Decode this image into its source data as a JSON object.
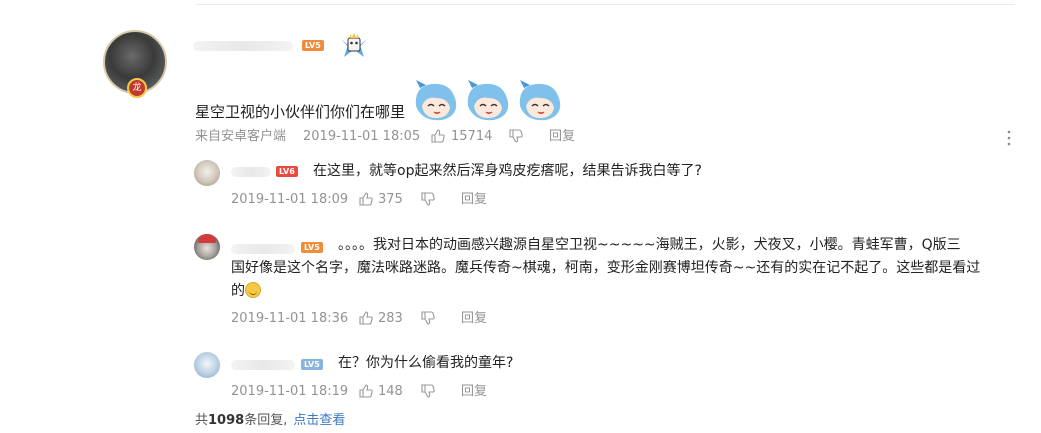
{
  "main": {
    "level": "LV5",
    "text": "星空卫视的小伙伴们你们在哪里",
    "source": "来自安卓客户端",
    "time": "2019-11-01 18:05",
    "likes": "15714",
    "reply_label": "回复"
  },
  "replies": [
    {
      "level": "LV6",
      "text": "在这里，就等op起来然后浑身鸡皮疙瘩呢，结果告诉我白等了?",
      "time": "2019-11-01 18:09",
      "likes": "375",
      "reply_label": "回复"
    },
    {
      "level": "LV5",
      "text_line1": "。。。。我对日本的动画感兴趣源自星空卫视~~~~~海贼王，火影，犬夜叉，小樱。青蛙军曹，Q版三",
      "text_line2": "国好像是这个名字，魔法咪路迷路。魔兵传奇~棋魂，柯南，变形金刚赛博坦传奇~~还有的实在记不起了。这些都是看过",
      "text_line3": "的",
      "time": "2019-11-01 18:36",
      "likes": "283",
      "reply_label": "回复"
    },
    {
      "level": "LV5",
      "text": "在？你为什么偷看我的童年?",
      "time": "2019-11-01 18:19",
      "likes": "148",
      "reply_label": "回复"
    }
  ],
  "footer": {
    "prefix": "共",
    "count": "1098",
    "suffix": "条回复,",
    "link": "点击查看"
  },
  "colors": {
    "meta_gray": "#939393",
    "link_blue": "#3b78c2",
    "level_orange": "#f08c3a"
  }
}
